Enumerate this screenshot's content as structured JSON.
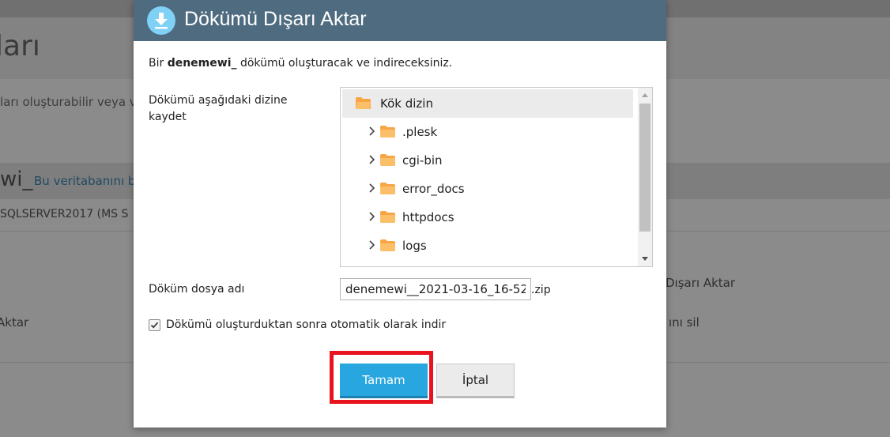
{
  "background": {
    "title": "ları",
    "description": "ları oluşturabilir veya v",
    "db_name": "wi_",
    "db_link": "Bu veritabanını b",
    "server": "SQLSERVER2017 (MS S",
    "action_export": "Dışarı Aktar",
    "action_delete": "ını sil",
    "action_import": "Aktar"
  },
  "dialog": {
    "title": "Dökümü Dışarı Aktar",
    "intro_prefix": "Bir",
    "intro_db": "denemewi_",
    "intro_suffix": "dökümü oluşturacak ve indireceksiniz.",
    "directory_label": "Dökümü aşağıdaki dizine kaydet",
    "tree": [
      {
        "label": "Kök dizin",
        "expandable": false,
        "selected": true
      },
      {
        "label": ".plesk",
        "expandable": true,
        "selected": false
      },
      {
        "label": "cgi-bin",
        "expandable": true,
        "selected": false
      },
      {
        "label": "error_docs",
        "expandable": true,
        "selected": false
      },
      {
        "label": "httpdocs",
        "expandable": true,
        "selected": false
      },
      {
        "label": "logs",
        "expandable": true,
        "selected": false
      }
    ],
    "filename_label": "Döküm dosya adı",
    "filename_value": "denemewi__2021-03-16_16-52",
    "filename_ext": ".zip",
    "auto_download_label": "Dökümü oluşturduktan sonra otomatik olarak indir",
    "auto_download_checked": true,
    "ok_label": "Tamam",
    "cancel_label": "İptal"
  },
  "colors": {
    "header": "#4f6b80",
    "primary": "#28a6df",
    "highlight": "#e8131f",
    "folder": "#f7a646"
  }
}
